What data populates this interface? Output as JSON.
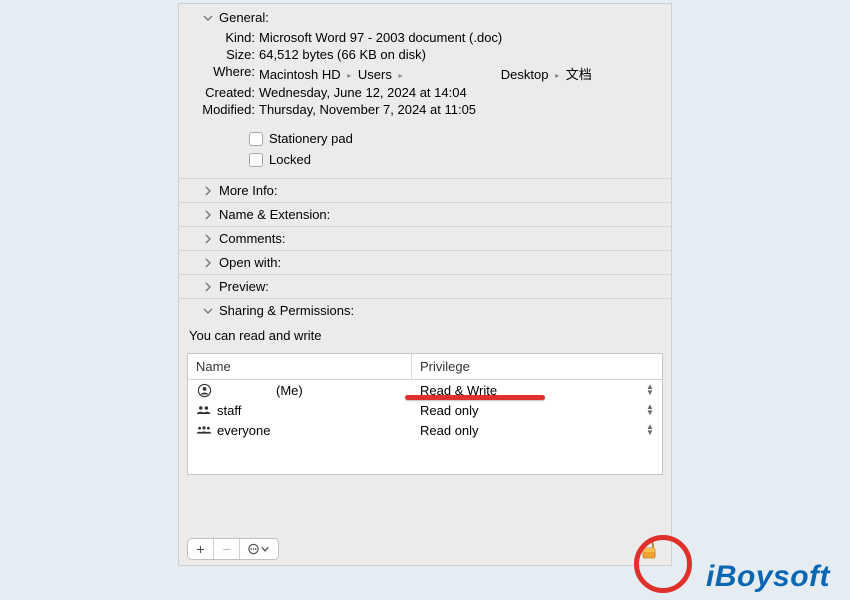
{
  "sections": {
    "general": {
      "label": "General:",
      "kind_label": "Kind:",
      "kind": "Microsoft Word 97 - 2003 document (.doc)",
      "size_label": "Size:",
      "size": "64,512 bytes (66 KB on disk)",
      "where_label": "Where:",
      "where_part1": "Macintosh HD",
      "where_part2": "Users",
      "where_part3": "Desktop",
      "where_part4": "文档",
      "created_label": "Created:",
      "created": "Wednesday, June 12, 2024 at 14:04",
      "modified_label": "Modified:",
      "modified": "Thursday, November 7, 2024 at 11:05",
      "stationery": "Stationery pad",
      "locked": "Locked"
    },
    "more_info": "More Info:",
    "name_ext": "Name & Extension:",
    "comments": "Comments:",
    "open_with": "Open with:",
    "preview": "Preview:",
    "sharing": {
      "label": "Sharing & Permissions:",
      "status": "You can read and write",
      "col_name": "Name",
      "col_priv": "Privilege",
      "rows": [
        {
          "user_suffix": "(Me)",
          "priv": "Read & Write",
          "icon": "person"
        },
        {
          "user": "staff",
          "priv": "Read only",
          "icon": "group"
        },
        {
          "user": "everyone",
          "priv": "Read only",
          "icon": "group3"
        }
      ]
    }
  },
  "brand": "iBoysoft"
}
